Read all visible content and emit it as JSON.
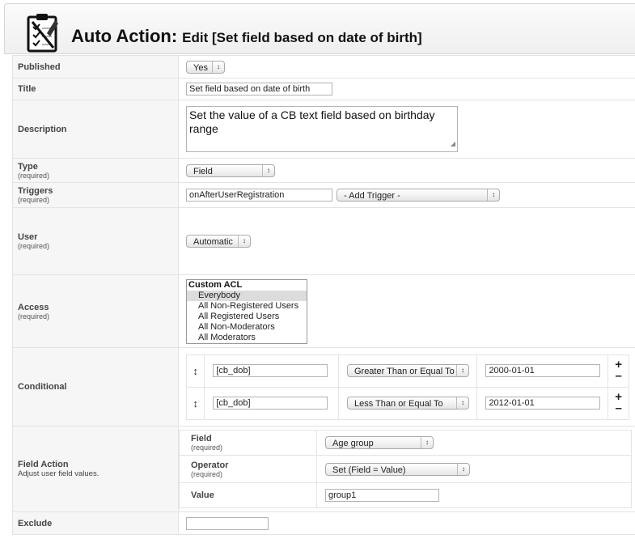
{
  "header": {
    "title": "Auto Action:",
    "subtitle": "Edit [Set field based on date of birth]",
    "icon": "clipboard-checklist-icon"
  },
  "required_text": "(required)",
  "fields": {
    "published": {
      "label": "Published",
      "value": "Yes"
    },
    "title": {
      "label": "Title",
      "value": "Set field based on date of birth"
    },
    "description": {
      "label": "Description",
      "value": "Set the value of a CB text field based on birthday range"
    },
    "type": {
      "label": "Type",
      "value": "Field"
    },
    "triggers": {
      "label": "Triggers",
      "value": "onAfterUserRegistration",
      "add_trigger": "- Add Trigger -"
    },
    "user": {
      "label": "User",
      "value": "Automatic"
    },
    "access": {
      "label": "Access",
      "group": "Custom ACL",
      "options": [
        "Everybody",
        "All Non-Registered Users",
        "All Registered Users",
        "All Non-Moderators",
        "All Moderators"
      ],
      "selected": "Everybody"
    },
    "conditional": {
      "label": "Conditional",
      "rows": [
        {
          "field": "[cb_dob]",
          "operator": "Greater Than or Equal To",
          "value": "2000-01-01"
        },
        {
          "field": "[cb_dob]",
          "operator": "Less Than or Equal To",
          "value": "2012-01-01"
        }
      ],
      "plus": "+",
      "minus": "–",
      "move": "↕"
    },
    "field_action": {
      "label": "Field Action",
      "description": "Adjust user field values.",
      "field_label": "Field",
      "field_value": "Age group",
      "operator_label": "Operator",
      "operator_value": "Set (Field = Value)",
      "value_label": "Value",
      "value_value": "group1"
    },
    "exclude": {
      "label": "Exclude",
      "value": ""
    }
  },
  "select_arrow": "↕"
}
